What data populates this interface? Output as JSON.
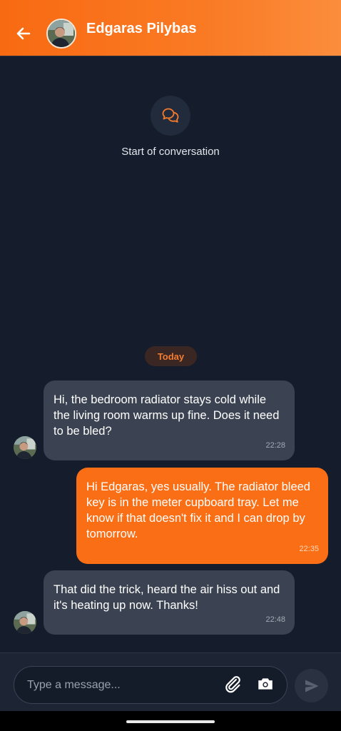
{
  "header": {
    "contact_name": "Edgaras Pilybas",
    "back_icon": "arrow-left-icon",
    "avatar_icon": "contact-avatar"
  },
  "conversation": {
    "start_icon": "chat-bubbles-icon",
    "start_label": "Start of conversation",
    "date_badge": "Today",
    "messages": [
      {
        "direction": "incoming",
        "text": "Hi, the bedroom radiator stays cold while the living room warms up fine. Does it need to be bled?",
        "time": "22:28"
      },
      {
        "direction": "outgoing",
        "text": "Hi Edgaras, yes usually. The radiator bleed key is in the meter cupboard tray. Let me know if that doesn't fix it and I can drop by tomorrow.",
        "time": "22:35"
      },
      {
        "direction": "incoming",
        "text": "That did the trick, heard the air hiss out and it's heating up now. Thanks!",
        "time": "22:48"
      }
    ]
  },
  "composer": {
    "placeholder": "Type a message...",
    "attach_icon": "paperclip-icon",
    "camera_icon": "camera-icon",
    "send_icon": "send-icon"
  },
  "colors": {
    "accent": "#fa6e15",
    "background": "#151c2b",
    "incoming_bubble": "#3b4352"
  }
}
